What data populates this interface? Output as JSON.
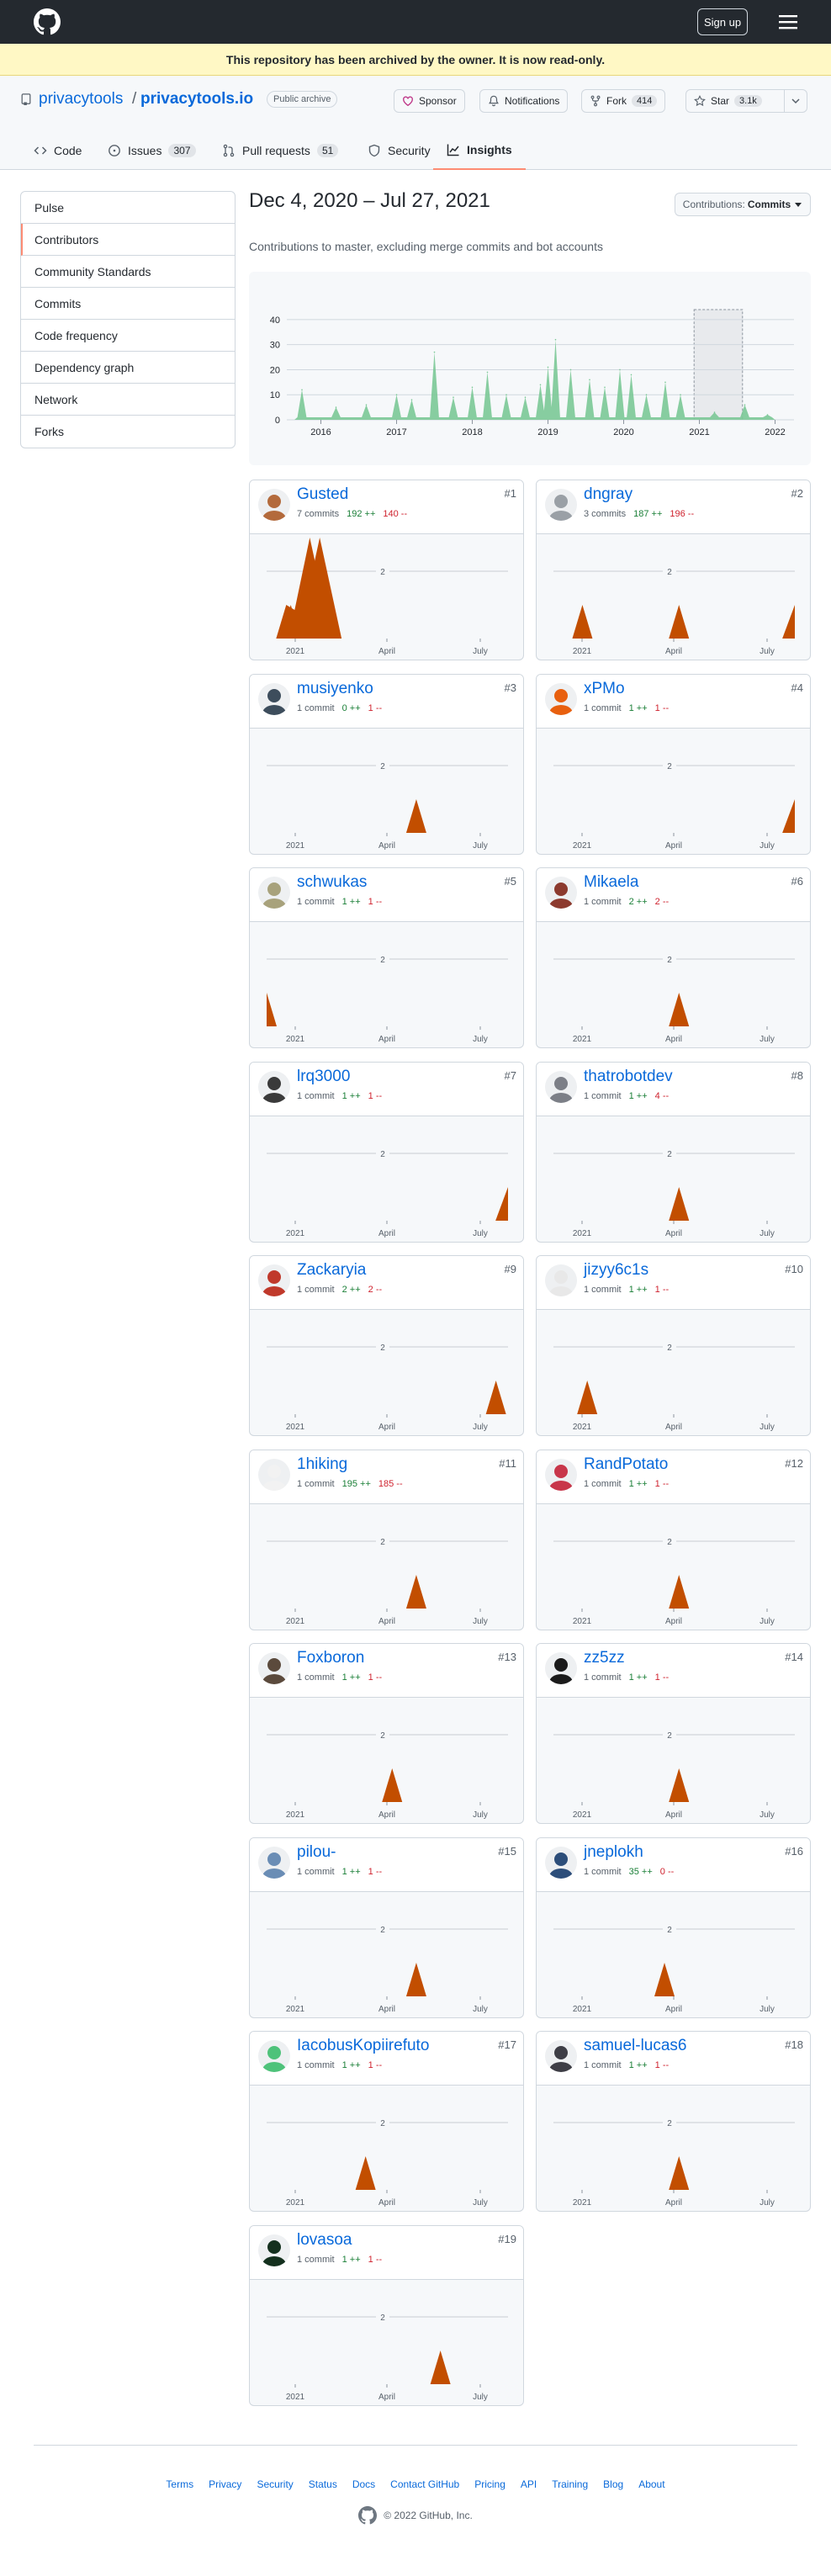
{
  "header": {
    "signup_label": "Sign up"
  },
  "banner": {
    "text": "This repository has been archived by the owner. It is now read-only."
  },
  "repo": {
    "owner": "privacytools",
    "slash": "/",
    "name": "privacytools.io",
    "visibility": "Public archive",
    "sponsor_label": "Sponsor",
    "notifications_label": "Notifications",
    "fork_label": "Fork",
    "fork_count": "414",
    "star_label": "Star",
    "star_count": "3.1k"
  },
  "tabs": [
    {
      "label": "Code",
      "icon": "code-icon"
    },
    {
      "label": "Issues",
      "count": "307",
      "icon": "issue-icon"
    },
    {
      "label": "Pull requests",
      "count": "51",
      "icon": "pull-request-icon"
    },
    {
      "label": "Security",
      "icon": "shield-icon"
    },
    {
      "label": "Insights",
      "icon": "graph-icon",
      "selected": true
    }
  ],
  "sidebar": {
    "items": [
      {
        "label": "Pulse"
      },
      {
        "label": "Contributors",
        "selected": true
      },
      {
        "label": "Community Standards"
      },
      {
        "label": "Commits"
      },
      {
        "label": "Code frequency"
      },
      {
        "label": "Dependency graph"
      },
      {
        "label": "Network"
      },
      {
        "label": "Forks"
      }
    ]
  },
  "insights": {
    "date_range": "Dec 4, 2020 – Jul 27, 2021",
    "contributions_label": "Contributions:",
    "contributions_value": "Commits",
    "subtitle": "Contributions to master, excluding merge commits and bot accounts"
  },
  "chart_data": {
    "type": "area",
    "main": {
      "x_ticks": [
        "2016",
        "2017",
        "2018",
        "2019",
        "2020",
        "2021",
        "2022"
      ],
      "y_ticks": [
        0,
        10,
        20,
        30,
        40
      ],
      "ylim": [
        0,
        45
      ],
      "series_color": "#7bc896",
      "highlight": {
        "from": "Dec 4, 2020",
        "to": "Jul 27, 2021"
      },
      "peaks": [
        {
          "x": 2015.75,
          "y": 12
        },
        {
          "x": 2016.2,
          "y": 5
        },
        {
          "x": 2016.6,
          "y": 6
        },
        {
          "x": 2017.0,
          "y": 10
        },
        {
          "x": 2017.2,
          "y": 8
        },
        {
          "x": 2017.5,
          "y": 27
        },
        {
          "x": 2017.75,
          "y": 9
        },
        {
          "x": 2018.0,
          "y": 13
        },
        {
          "x": 2018.2,
          "y": 19
        },
        {
          "x": 2018.45,
          "y": 10
        },
        {
          "x": 2018.7,
          "y": 9
        },
        {
          "x": 2018.9,
          "y": 14
        },
        {
          "x": 2019.0,
          "y": 21
        },
        {
          "x": 2019.1,
          "y": 32
        },
        {
          "x": 2019.3,
          "y": 20
        },
        {
          "x": 2019.55,
          "y": 16
        },
        {
          "x": 2019.75,
          "y": 13
        },
        {
          "x": 2019.95,
          "y": 20
        },
        {
          "x": 2020.1,
          "y": 18
        },
        {
          "x": 2020.3,
          "y": 10
        },
        {
          "x": 2020.55,
          "y": 15
        },
        {
          "x": 2020.75,
          "y": 10
        },
        {
          "x": 2021.2,
          "y": 3
        },
        {
          "x": 2021.6,
          "y": 6
        },
        {
          "x": 2021.9,
          "y": 2
        }
      ]
    },
    "contributor_charts": {
      "x_labels": [
        "2021",
        "April",
        "July"
      ],
      "y_tick": 2,
      "ylim": [
        0,
        3
      ],
      "color": "#c24e00"
    },
    "contributors": [
      {
        "rank": "#1",
        "name": "Gusted",
        "commits": "7 commits",
        "additions": "192 ++",
        "deletions": "140 --",
        "avatar_color": "#b36a3c",
        "peaks": [
          {
            "x": 0.1,
            "y": 1
          },
          {
            "x": 0.22,
            "y": 3
          }
        ]
      },
      {
        "rank": "#2",
        "name": "dngray",
        "commits": "3 commits",
        "additions": "187 ++",
        "deletions": "196 --",
        "avatar_color": "#9aa0a6",
        "peaks": [
          {
            "x": 0.12,
            "y": 1
          },
          {
            "x": 0.52,
            "y": 1
          },
          {
            "x": 0.99,
            "y": 1
          }
        ]
      },
      {
        "rank": "#3",
        "name": "musiyenko",
        "commits": "1 commit",
        "additions": "0 ++",
        "deletions": "1 --",
        "avatar_color": "#3d4d5c",
        "peaks": [
          {
            "x": 0.62,
            "y": 1
          }
        ]
      },
      {
        "rank": "#4",
        "name": "xPMo",
        "commits": "1 commit",
        "additions": "1 ++",
        "deletions": "1 --",
        "avatar_color": "#e8600f",
        "peaks": [
          {
            "x": 0.99,
            "y": 1
          }
        ]
      },
      {
        "rank": "#5",
        "name": "schwukas",
        "commits": "1 commit",
        "additions": "1 ++",
        "deletions": "1 --",
        "avatar_color": "#a8a27c",
        "peaks": [
          {
            "x": 0.0,
            "y": 1
          }
        ]
      },
      {
        "rank": "#6",
        "name": "Mikaela",
        "commits": "1 commit",
        "additions": "2 ++",
        "deletions": "2 --",
        "avatar_color": "#8c3a2e",
        "peaks": [
          {
            "x": 0.52,
            "y": 1
          }
        ]
      },
      {
        "rank": "#7",
        "name": "lrq3000",
        "commits": "1 commit",
        "additions": "1 ++",
        "deletions": "1 --",
        "avatar_color": "#3a3a3a",
        "peaks": [
          {
            "x": 0.99,
            "y": 1
          }
        ]
      },
      {
        "rank": "#8",
        "name": "thatrobotdev",
        "commits": "1 commit",
        "additions": "1 ++",
        "deletions": "4 --",
        "avatar_color": "#7c7f87",
        "peaks": [
          {
            "x": 0.52,
            "y": 1
          }
        ]
      },
      {
        "rank": "#9",
        "name": "Zackaryia",
        "commits": "1 commit",
        "additions": "2 ++",
        "deletions": "2 --",
        "avatar_color": "#c0392b",
        "peaks": [
          {
            "x": 0.95,
            "y": 1
          }
        ]
      },
      {
        "rank": "#10",
        "name": "jizyy6c1s",
        "commits": "1 commit",
        "additions": "1 ++",
        "deletions": "1 --",
        "avatar_color": "#e8e8e8",
        "peaks": [
          {
            "x": 0.14,
            "y": 1
          }
        ]
      },
      {
        "rank": "#11",
        "name": "1hiking",
        "commits": "1 commit",
        "additions": "195 ++",
        "deletions": "185 --",
        "avatar_color": "#f2f2f2",
        "peaks": [
          {
            "x": 0.62,
            "y": 1
          }
        ]
      },
      {
        "rank": "#12",
        "name": "RandPotato",
        "commits": "1 commit",
        "additions": "1 ++",
        "deletions": "1 --",
        "avatar_color": "#c8364a",
        "peaks": [
          {
            "x": 0.52,
            "y": 1
          }
        ]
      },
      {
        "rank": "#13",
        "name": "Foxboron",
        "commits": "1 commit",
        "additions": "1 ++",
        "deletions": "1 --",
        "avatar_color": "#5b4a3c",
        "peaks": [
          {
            "x": 0.52,
            "y": 1
          }
        ]
      },
      {
        "rank": "#14",
        "name": "zz5zz",
        "commits": "1 commit",
        "additions": "1 ++",
        "deletions": "1 --",
        "avatar_color": "#1b1b1b",
        "peaks": [
          {
            "x": 0.52,
            "y": 1
          }
        ]
      },
      {
        "rank": "#15",
        "name": "pilou-",
        "commits": "1 commit",
        "additions": "1 ++",
        "deletions": "1 --",
        "avatar_color": "#6a8db5",
        "peaks": [
          {
            "x": 0.62,
            "y": 1
          }
        ]
      },
      {
        "rank": "#16",
        "name": "jneplokh",
        "commits": "1 commit",
        "additions": "35 ++",
        "deletions": "0 --",
        "avatar_color": "#2d4e7a",
        "peaks": [
          {
            "x": 0.46,
            "y": 1
          }
        ]
      },
      {
        "rank": "#17",
        "name": "IacobusKopiirefuto",
        "commits": "1 commit",
        "additions": "1 ++",
        "deletions": "1 --",
        "avatar_color": "#4ec27a",
        "peaks": [
          {
            "x": 0.41,
            "y": 1
          }
        ]
      },
      {
        "rank": "#18",
        "name": "samuel-lucas6",
        "commits": "1 commit",
        "additions": "1 ++",
        "deletions": "1 --",
        "avatar_color": "#3e3e46",
        "peaks": [
          {
            "x": 0.52,
            "y": 1
          }
        ]
      },
      {
        "rank": "#19",
        "name": "lovasoa",
        "commits": "1 commit",
        "additions": "1 ++",
        "deletions": "1 --",
        "avatar_color": "#14301e",
        "peaks": [
          {
            "x": 0.72,
            "y": 1
          }
        ]
      }
    ]
  },
  "footer": {
    "links": [
      "Terms",
      "Privacy",
      "Security",
      "Status",
      "Docs",
      "Contact GitHub",
      "Pricing",
      "API",
      "Training",
      "Blog",
      "About"
    ],
    "copyright": "© 2022 GitHub, Inc."
  }
}
